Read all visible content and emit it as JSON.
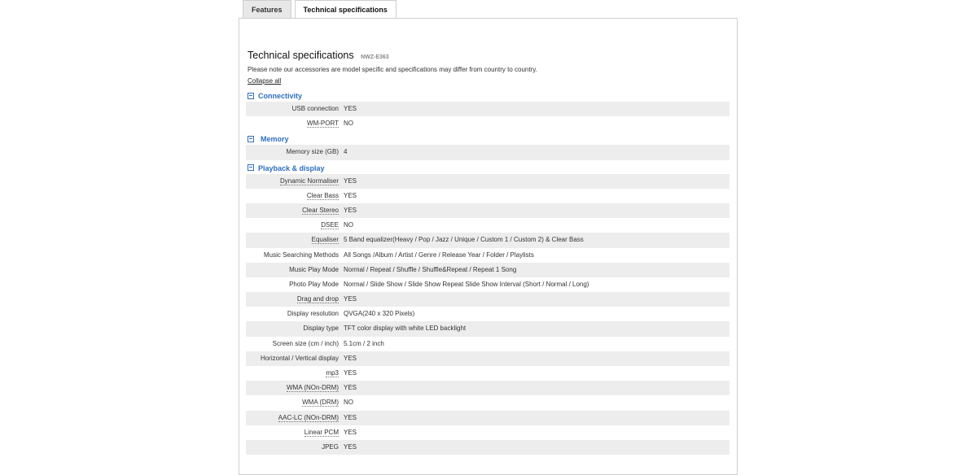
{
  "tabs": [
    {
      "label": "Features"
    },
    {
      "label": "Technical specifications"
    }
  ],
  "heading": {
    "title": "Technical specifications",
    "model": "NWZ-E363"
  },
  "note": "Please note our accessories are model specific and specifications may differ from country to country.",
  "collapse_all": "Collapse all",
  "sections": [
    {
      "title": "Connectivity",
      "rows": [
        {
          "label": "USB connection",
          "value": "YES"
        },
        {
          "label": "WM-PORT",
          "value": "NO"
        }
      ]
    },
    {
      "title": "Memory",
      "rows": [
        {
          "label": "Memory size (GB)",
          "value": "4"
        }
      ]
    },
    {
      "title": "Playback & display",
      "rows": [
        {
          "label": "Dynamic Normaliser",
          "value": "YES"
        },
        {
          "label": "Clear Bass",
          "value": "YES"
        },
        {
          "label": "Clear Stereo",
          "value": "YES"
        },
        {
          "label": "DSEE",
          "value": "NO"
        },
        {
          "label": "Equaliser",
          "value": "5 Band equalizer(Heavy / Pop / Jazz / Unique / Custom 1 / Custom 2) & Clear Bass"
        },
        {
          "label": "Music Searching Methods",
          "value": "All Songs /Album / Artist / Genre / Release Year / Folder / Playlists"
        },
        {
          "label": "Music Play Mode",
          "value": "Normal / Repeat / Shuffle / Shuffle&Repeat / Repeat 1 Song"
        },
        {
          "label": "Photo Play Mode",
          "value": "Normal / Slide Show / Slide Show Repeat Slide Show Interval (Short / Normal / Long)"
        },
        {
          "label": "Drag and drop",
          "value": "YES"
        },
        {
          "label": "Display resolution",
          "value": "QVGA(240 x 320 Pixels)"
        },
        {
          "label": "Display type",
          "value": "TFT color display with white LED backlight"
        },
        {
          "label": "Screen size (cm / inch)",
          "value": "5.1cm / 2 inch"
        },
        {
          "label": "Horizontal / Vertical display",
          "value": "YES"
        },
        {
          "label": "mp3",
          "value": "YES"
        },
        {
          "label": "WMA (NOn-DRM)",
          "value": "YES"
        },
        {
          "label": "WMA (DRM)",
          "value": "NO"
        },
        {
          "label": "AAC-LC (NOn-DRM)",
          "value": "YES"
        },
        {
          "label": "Linear PCM",
          "value": "YES"
        },
        {
          "label": "JPEG",
          "value": "YES"
        }
      ]
    }
  ]
}
